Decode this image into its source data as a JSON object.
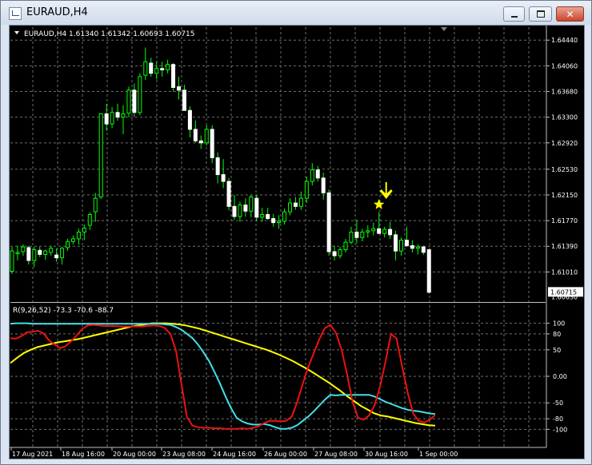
{
  "window": {
    "title": "EURAUD,H4",
    "minimize_icon": "minimize-icon",
    "restore_icon": "restore-icon",
    "close_icon": "close-icon"
  },
  "chart": {
    "header": "EURAUD,H4  1.61340 1.61342 1.60693 1.60715",
    "current_price": "1.60715",
    "hidden_price": "1.60630",
    "price_ticks": [
      "1.64440",
      "1.64060",
      "1.63680",
      "1.63300",
      "1.62920",
      "1.62530",
      "1.62150",
      "1.61770",
      "1.61390",
      "1.61010"
    ],
    "price_range": [
      1.6066,
      1.6449
    ],
    "candles": [
      [
        1.6102,
        1.6138,
        1.6098,
        1.6132
      ],
      [
        1.6128,
        1.614,
        1.6118,
        1.613
      ],
      [
        1.6131,
        1.6142,
        1.6125,
        1.6138
      ],
      [
        1.6137,
        1.614,
        1.6112,
        1.6118
      ],
      [
        1.6118,
        1.6138,
        1.6108,
        1.6134
      ],
      [
        1.6133,
        1.6138,
        1.6123,
        1.6127
      ],
      [
        1.6127,
        1.6134,
        1.6119,
        1.6132
      ],
      [
        1.613,
        1.614,
        1.6125,
        1.6136
      ],
      [
        1.6126,
        1.6136,
        1.6116,
        1.6122
      ],
      [
        1.6122,
        1.6138,
        1.6112,
        1.6136
      ],
      [
        1.6137,
        1.615,
        1.6132,
        1.6146
      ],
      [
        1.6146,
        1.6155,
        1.6142,
        1.615
      ],
      [
        1.615,
        1.6165,
        1.6141,
        1.616
      ],
      [
        1.616,
        1.6171,
        1.6148,
        1.6166
      ],
      [
        1.617,
        1.6189,
        1.6163,
        1.6186
      ],
      [
        1.619,
        1.6218,
        1.6175,
        1.621
      ],
      [
        1.6212,
        1.632,
        1.6209,
        1.6335
      ],
      [
        1.6335,
        1.635,
        1.631,
        1.632
      ],
      [
        1.632,
        1.6345,
        1.6314,
        1.6337
      ],
      [
        1.6337,
        1.635,
        1.6325,
        1.633
      ],
      [
        1.633,
        1.6348,
        1.6305,
        1.6335
      ],
      [
        1.6336,
        1.6375,
        1.633,
        1.637
      ],
      [
        1.637,
        1.638,
        1.633,
        1.6337
      ],
      [
        1.6337,
        1.6395,
        1.6333,
        1.639
      ],
      [
        1.6392,
        1.6433,
        1.6385,
        1.6412
      ],
      [
        1.641,
        1.6418,
        1.639,
        1.6395
      ],
      [
        1.6395,
        1.6412,
        1.6386,
        1.6402
      ],
      [
        1.6402,
        1.6412,
        1.639,
        1.64
      ],
      [
        1.64,
        1.6415,
        1.6395,
        1.6408
      ],
      [
        1.6408,
        1.641,
        1.6368,
        1.6374
      ],
      [
        1.6375,
        1.639,
        1.6356,
        1.637
      ],
      [
        1.637,
        1.6378,
        1.634,
        1.634
      ],
      [
        1.634,
        1.6346,
        1.63,
        1.6312
      ],
      [
        1.6312,
        1.6325,
        1.6292,
        1.6295
      ],
      [
        1.6295,
        1.6303,
        1.6283,
        1.6292
      ],
      [
        1.6292,
        1.6318,
        1.6288,
        1.6312
      ],
      [
        1.6312,
        1.6318,
        1.6262,
        1.627
      ],
      [
        1.627,
        1.6278,
        1.6232,
        1.6245
      ],
      [
        1.6245,
        1.6268,
        1.6225,
        1.6235
      ],
      [
        1.6235,
        1.624,
        1.6192,
        1.6198
      ],
      [
        1.6198,
        1.6215,
        1.6178,
        1.6183
      ],
      [
        1.6183,
        1.6205,
        1.6175,
        1.62
      ],
      [
        1.62,
        1.621,
        1.6183,
        1.6191
      ],
      [
        1.6191,
        1.6215,
        1.6182,
        1.6212
      ],
      [
        1.621,
        1.6215,
        1.6176,
        1.6182
      ],
      [
        1.6182,
        1.6196,
        1.6175,
        1.6186
      ],
      [
        1.6186,
        1.6196,
        1.6178,
        1.618
      ],
      [
        1.618,
        1.6187,
        1.6168,
        1.6174
      ],
      [
        1.6174,
        1.6185,
        1.6165,
        1.6176
      ],
      [
        1.6176,
        1.6195,
        1.6171,
        1.619
      ],
      [
        1.619,
        1.621,
        1.6185,
        1.6203
      ],
      [
        1.6203,
        1.6212,
        1.6193,
        1.6198
      ],
      [
        1.6198,
        1.622,
        1.6193,
        1.621
      ],
      [
        1.621,
        1.6242,
        1.6203,
        1.6235
      ],
      [
        1.6235,
        1.6262,
        1.6229,
        1.6252
      ],
      [
        1.6252,
        1.6258,
        1.6235,
        1.624
      ],
      [
        1.624,
        1.6248,
        1.6208,
        1.6218
      ],
      [
        1.6218,
        1.6223,
        1.6125,
        1.6131
      ],
      [
        1.6131,
        1.614,
        1.6118,
        1.6125
      ],
      [
        1.6125,
        1.6138,
        1.6121,
        1.6134
      ],
      [
        1.6134,
        1.615,
        1.613,
        1.6145
      ],
      [
        1.6145,
        1.6168,
        1.6142,
        1.616
      ],
      [
        1.616,
        1.6178,
        1.6143,
        1.6152
      ],
      [
        1.6152,
        1.6165,
        1.6146,
        1.616
      ],
      [
        1.616,
        1.617,
        1.6152,
        1.6162
      ],
      [
        1.6162,
        1.6174,
        1.6155,
        1.6165
      ],
      [
        1.6165,
        1.619,
        1.616,
        1.6158
      ],
      [
        1.6158,
        1.6168,
        1.6152,
        1.6164
      ],
      [
        1.6164,
        1.6175,
        1.615,
        1.6156
      ],
      [
        1.6156,
        1.6162,
        1.6118,
        1.6132
      ],
      [
        1.6132,
        1.6152,
        1.6125,
        1.6148
      ],
      [
        1.6148,
        1.6168,
        1.6138,
        1.614
      ],
      [
        1.614,
        1.6148,
        1.613,
        1.6136
      ],
      [
        1.6136,
        1.6142,
        1.6127,
        1.6138
      ],
      [
        1.6138,
        1.614,
        1.6126,
        1.613
      ],
      [
        1.6134,
        1.6134,
        1.6069,
        1.6071
      ]
    ],
    "arrow_color": "#ffff00",
    "time_labels": [
      "17 Aug 2021",
      "18 Aug 16:00",
      "20 Aug 00:00",
      "23 Aug 08:00",
      "24 Aug 16:00",
      "26 Aug 00:00",
      "27 Aug 08:00",
      "30 Aug 16:00",
      "1 Sep 00:00"
    ]
  },
  "indicator": {
    "header": "R(9,26,52) -73.3 -70.6 -88.7",
    "levels": [
      "100",
      "80",
      "50",
      "0.00",
      "-50",
      "-80",
      "-100"
    ],
    "range": [
      -110,
      110
    ],
    "red": [
      72,
      71,
      76,
      83,
      84,
      86,
      81,
      68,
      60,
      53,
      57,
      66,
      77,
      89,
      96,
      97,
      96,
      95,
      95,
      95,
      94,
      94,
      94,
      94,
      94,
      95,
      96,
      95,
      91,
      80,
      49,
      -14,
      -77,
      -93,
      -96,
      -97,
      -97,
      -98,
      -98,
      -99,
      -99,
      -99,
      -98,
      -99,
      -97,
      -94,
      -88,
      -84,
      -84,
      -85,
      -84,
      -76,
      -48,
      -14,
      18,
      44,
      70,
      91,
      97,
      82,
      51,
      5,
      -47,
      -78,
      -82,
      -74,
      -55,
      -20,
      28,
      80,
      71,
      19,
      -30,
      -70,
      -84,
      -87,
      -82,
      -73
    ],
    "cyan": [
      99,
      100,
      100,
      100,
      99,
      99,
      99,
      99,
      99,
      99,
      99,
      99,
      99,
      99,
      99,
      99,
      99,
      99,
      99,
      99,
      99,
      99,
      99,
      99,
      99,
      99,
      99,
      99,
      98,
      97,
      93,
      88,
      80,
      72,
      60,
      45,
      29,
      8,
      -14,
      -38,
      -60,
      -78,
      -85,
      -89,
      -91,
      -91,
      -90,
      -92,
      -96,
      -99,
      -99,
      -97,
      -92,
      -84,
      -76,
      -66,
      -55,
      -44,
      -35,
      -36,
      -35,
      -35,
      -35,
      -35,
      -35,
      -35,
      -38,
      -43,
      -48,
      -52,
      -56,
      -60,
      -63,
      -65,
      -66,
      -68,
      -70,
      -71
    ],
    "yellow": [
      25,
      35,
      44,
      50,
      55,
      58,
      61,
      64,
      66,
      68,
      70,
      73,
      76,
      79,
      82,
      85,
      88,
      91,
      94,
      96,
      98,
      100,
      100,
      100,
      99,
      98,
      96,
      93,
      90,
      86,
      82,
      78,
      74,
      70,
      66,
      62,
      58,
      54,
      50,
      45,
      40,
      34,
      28,
      21,
      14,
      6,
      -2,
      -10,
      -19,
      -28,
      -38,
      -47,
      -56,
      -63,
      -70,
      -74,
      -76,
      -79,
      -82,
      -85,
      -88,
      -90,
      -92,
      -93
    ]
  }
}
